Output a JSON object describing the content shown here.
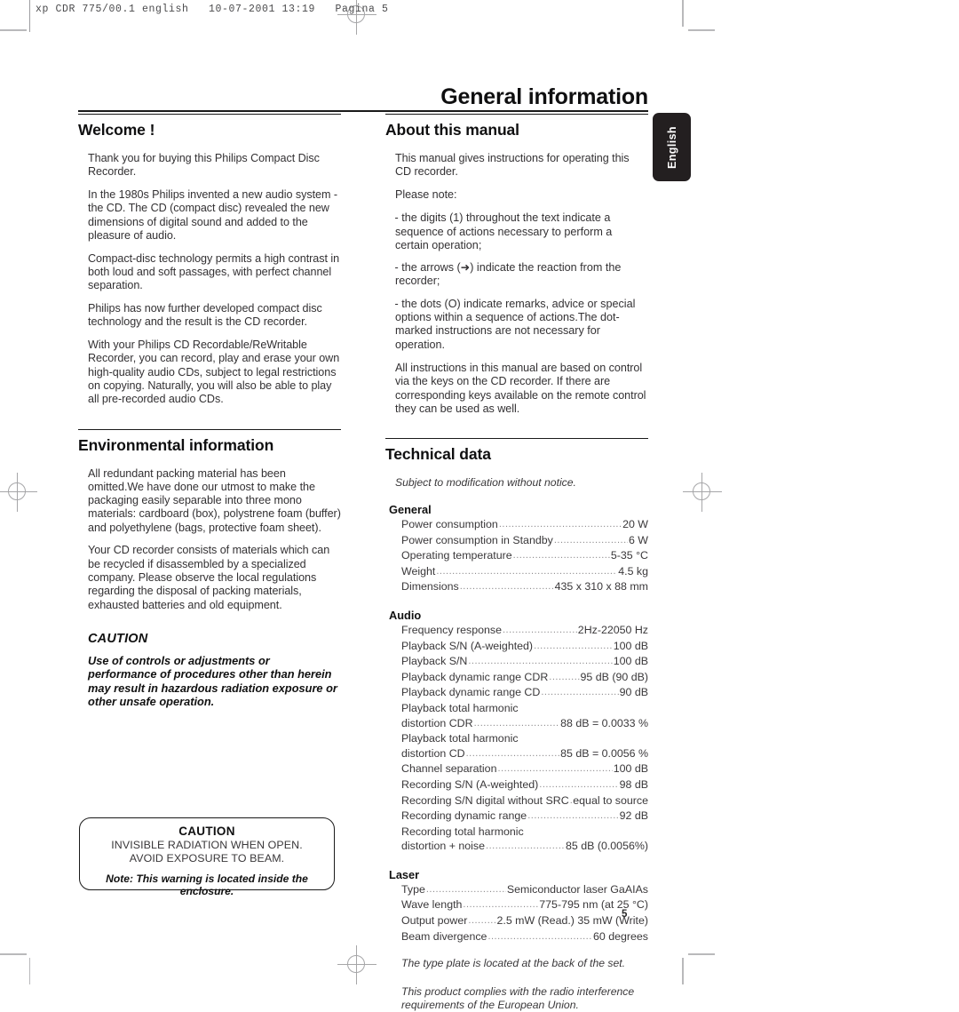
{
  "prepress": {
    "slug": "xp CDR 775/00.1 english   10-07-2001 13:19   Pagina 5"
  },
  "document": {
    "title": "General information",
    "page_number": "5",
    "language_tab": "English"
  },
  "left_column": {
    "welcome": {
      "heading": "Welcome !",
      "paragraphs": [
        "Thank you for buying this Philips Compact Disc Recorder.",
        "In the 1980s Philips invented a new audio system - the CD. The CD (compact disc) revealed the new dimensions of digital sound and added to the pleasure of audio.",
        "Compact-disc technology permits a high contrast in both loud and soft passages, with perfect channel separation.",
        "Philips has now further developed compact disc technology and the result is the CD recorder.",
        "With your Philips CD Recordable/ReWritable Recorder, you can record, play and erase your own high-quality audio CDs, subject to legal restrictions on copying. Naturally, you will also be able to play all pre-recorded audio CDs."
      ]
    },
    "environmental": {
      "heading": "Environmental information",
      "paragraphs": [
        "All redundant packing material has been omitted.We have done our utmost to make the packaging easily separable into three mono materials: cardboard (box), polystrene foam (buffer) and polyethylene (bags, protective foam sheet).",
        "Your CD recorder consists of materials which can be recycled if disassembled by a specialized company. Please observe the local regulations regarding the disposal of packing materials, exhausted batteries and old equipment."
      ]
    },
    "caution": {
      "heading": "CAUTION",
      "body": "Use of controls or adjustments or performance of procedures other than herein may result in hazardous radiation exposure or other unsafe operation."
    },
    "caution_box": {
      "title": "CAUTION",
      "line1": "INVISIBLE RADIATION WHEN OPEN.",
      "line2": "AVOID EXPOSURE TO BEAM.",
      "note": "Note: This warning is located inside the enclosure."
    }
  },
  "right_column": {
    "about_manual": {
      "heading": "About this manual",
      "intro": "This manual gives instructions for operating this CD recorder.",
      "please_note": "Please note:",
      "bullets": [
        "- the digits (1) throughout the text indicate a sequence of actions necessary to perform a certain operation;",
        "- the arrows (➜) indicate the reaction from the recorder;",
        "- the dots (O) indicate remarks, advice or special options within a sequence of actions.The dot-marked instructions are not necessary for operation."
      ],
      "closing": "All instructions in this manual are based on control via the keys on the CD recorder. If there are corresponding keys available on the remote control they can be used as well."
    },
    "technical_data": {
      "heading": "Technical data",
      "subject_note": "Subject to modification without notice.",
      "groups": [
        {
          "name": "General",
          "rows": [
            {
              "key": "Power consumption",
              "value": "20 W"
            },
            {
              "key": "Power consumption in Standby",
              "value": "6 W"
            },
            {
              "key": "Operating temperature",
              "value": "5-35 °C"
            },
            {
              "key": "Weight",
              "value": "4.5 kg"
            },
            {
              "key": "Dimensions",
              "value": "435 x 310 x 88 mm"
            }
          ]
        },
        {
          "name": "Audio",
          "rows": [
            {
              "key": "Frequency response",
              "value": "2Hz-22050 Hz"
            },
            {
              "key": "Playback S/N (A-weighted)",
              "value": "100 dB"
            },
            {
              "key": "Playback S/N",
              "value": " 100 dB"
            },
            {
              "key": "Playback dynamic range CDR",
              "value": "95 dB (90 dB)"
            },
            {
              "key": "Playback dynamic range CD",
              "value": "90 dB"
            },
            {
              "key": "Playback total harmonic",
              "value": "",
              "nodots": true
            },
            {
              "key": "distortion CDR",
              "value": "88 dB = 0.0033 %"
            },
            {
              "key": "Playback total harmonic",
              "value": "",
              "nodots": true
            },
            {
              "key": "distortion CD",
              "value": "85 dB = 0.0056 %"
            },
            {
              "key": "Channel separation",
              "value": "100 dB"
            },
            {
              "key": "Recording S/N (A-weighted)",
              "value": "98 dB"
            },
            {
              "key": "Recording S/N digital without SRC",
              "value": "equal to source"
            },
            {
              "key": "Recording dynamic range",
              "value": "92 dB"
            },
            {
              "key": "Recording total harmonic",
              "value": "",
              "nodots": true
            },
            {
              "key": "distortion + noise",
              "value": "85 dB (0.0056%)"
            }
          ]
        },
        {
          "name": "Laser",
          "rows": [
            {
              "key": "Type",
              "value": "Semiconductor laser GaAIAs"
            },
            {
              "key": "Wave length",
              "value": "775-795 nm (at 25 °C)"
            },
            {
              "key": "Output power",
              "value": "2.5 mW (Read.) 35 mW (Write)"
            },
            {
              "key": "Beam divergence",
              "value": "60 degrees"
            }
          ]
        }
      ],
      "notes": [
        "The type plate is located at the back of the set.",
        "This product complies with the radio interference requirements of the European Union."
      ]
    }
  }
}
